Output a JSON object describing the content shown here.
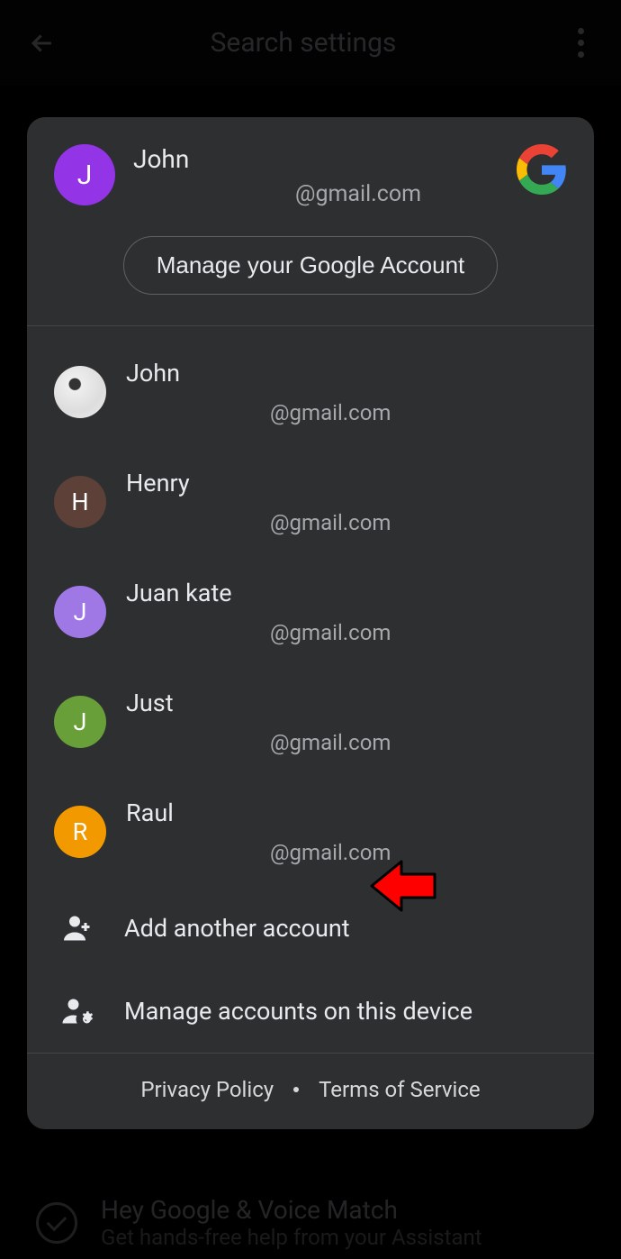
{
  "header": {
    "search_placeholder": "Search settings"
  },
  "primary": {
    "name": "John",
    "email": "@gmail.com",
    "initial": "J",
    "avatar_color": "#9334e6",
    "manage_label": "Manage your Google Account"
  },
  "accounts": [
    {
      "name": "John",
      "email": "@gmail.com",
      "initial": "",
      "avatar_color": "img"
    },
    {
      "name": "Henry",
      "email": "@gmail.com",
      "initial": "H",
      "avatar_color": "#5d4037"
    },
    {
      "name": "Juan kate",
      "email": "@gmail.com",
      "initial": "J",
      "avatar_color": "#a078e6"
    },
    {
      "name": "Just",
      "email": "@gmail.com",
      "initial": "J",
      "avatar_color": "#689f38"
    },
    {
      "name": "Raul",
      "email": "@gmail.com",
      "initial": "R",
      "avatar_color": "#f29900"
    }
  ],
  "actions": {
    "add_account": "Add another account",
    "manage_accounts": "Manage accounts on this device"
  },
  "footer": {
    "privacy": "Privacy Policy",
    "terms": "Terms of Service"
  },
  "bg": {
    "title": "Hey Google & Voice Match",
    "sub": "Get hands-free help from your Assistant"
  }
}
